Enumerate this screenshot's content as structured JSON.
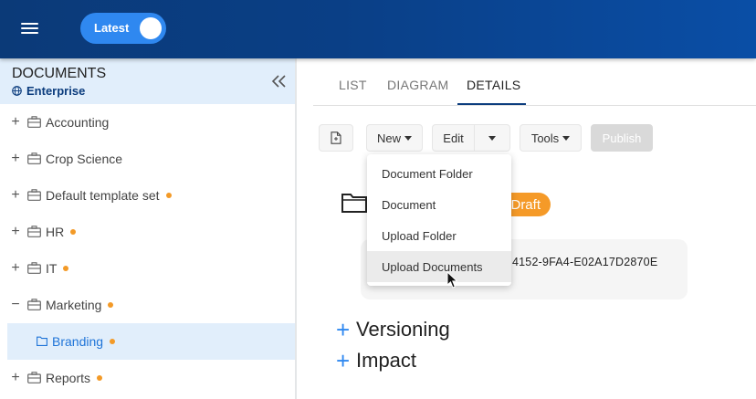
{
  "header": {
    "toggle_label": "Latest"
  },
  "sidebar": {
    "title": "DOCUMENTS",
    "subtitle": "Enterprise",
    "items": [
      {
        "label": "Accounting",
        "expander": "+"
      },
      {
        "label": "Crop Science",
        "expander": "+"
      },
      {
        "label": "Default template set",
        "expander": "+"
      },
      {
        "label": "HR",
        "expander": "+"
      },
      {
        "label": "IT",
        "expander": "+"
      },
      {
        "label": "Marketing",
        "expander": "−"
      },
      {
        "label": "Branding",
        "expander": ""
      },
      {
        "label": "Reports",
        "expander": "+"
      }
    ]
  },
  "tabs": [
    {
      "label": "LIST"
    },
    {
      "label": "DIAGRAM"
    },
    {
      "label": "DETAILS"
    }
  ],
  "toolbar": {
    "new_label": "New",
    "edit_label": "Edit",
    "tools_label": "Tools",
    "publish_label": "Publish"
  },
  "new_menu": {
    "items": [
      "Document Folder",
      "Document",
      "Upload Folder",
      "Upload Documents"
    ]
  },
  "details": {
    "status_badge": "Draft",
    "id_text": "4152-9FA4-E02A17D2870E",
    "sections": [
      "Versioning",
      "Impact"
    ]
  },
  "colors": {
    "accent": "#2f88f0",
    "header_dark": "#0b3a78",
    "status_dot": "#f39a27",
    "draft": "#f59a28",
    "selected_bg": "#e1eefb"
  }
}
